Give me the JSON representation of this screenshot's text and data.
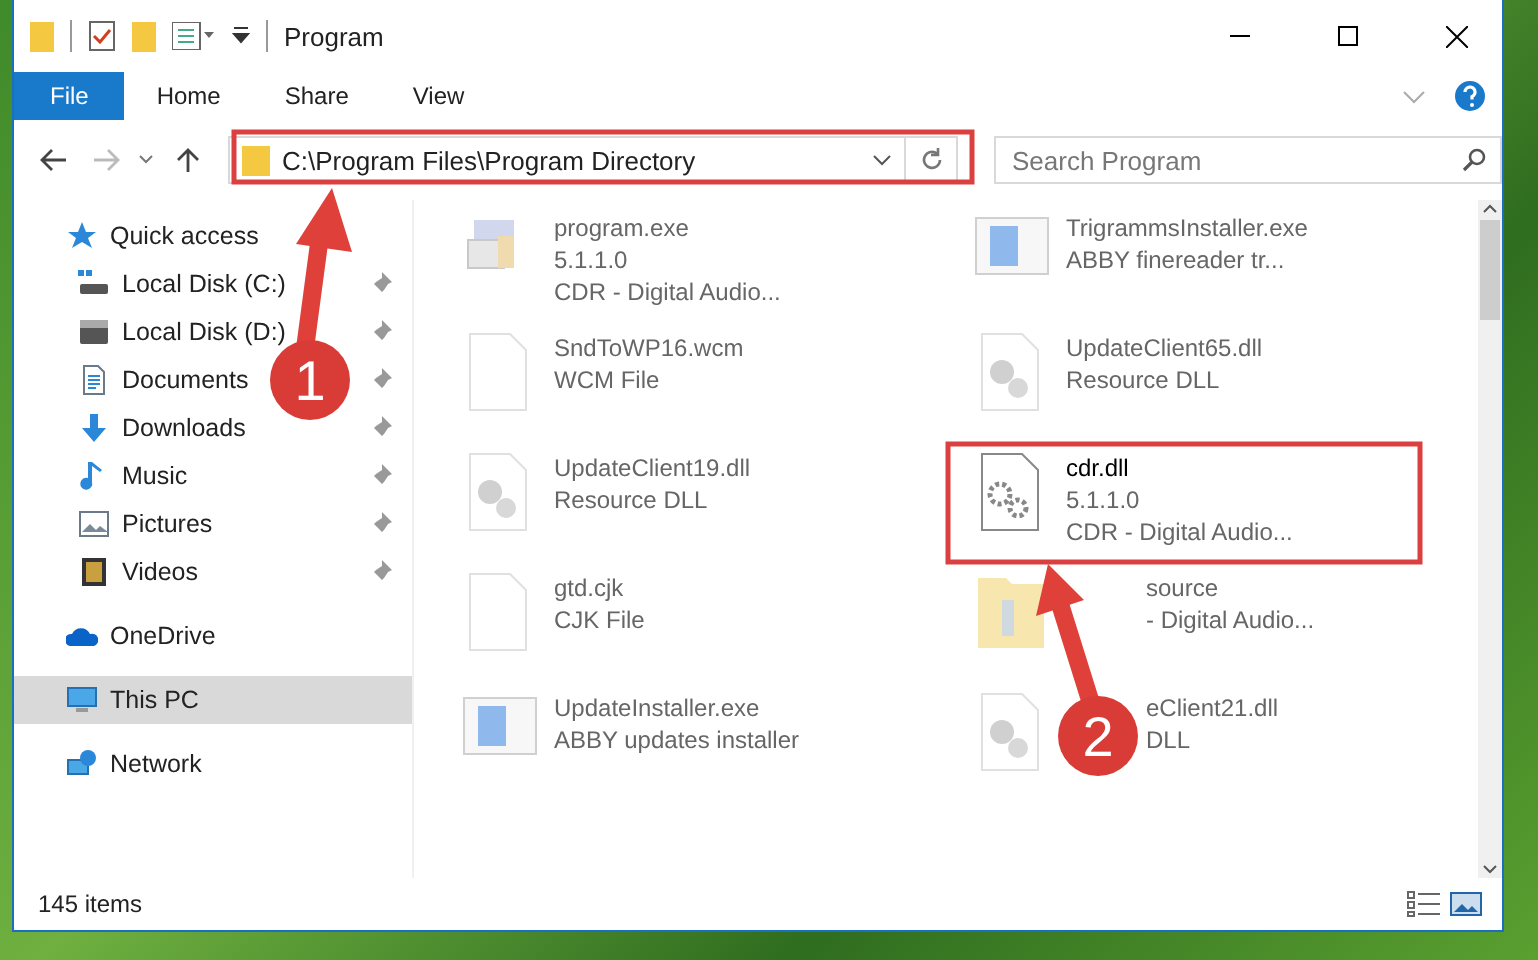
{
  "window": {
    "title": "Program"
  },
  "ribbon_tabs": [
    {
      "label": "File",
      "selected": true
    },
    {
      "label": "Home",
      "selected": false
    },
    {
      "label": "Share",
      "selected": false
    },
    {
      "label": "View",
      "selected": false
    }
  ],
  "address_bar": {
    "path": "C:\\Program Files\\Program Directory"
  },
  "search": {
    "placeholder": "Search Program"
  },
  "sidebar": {
    "items": [
      {
        "label": "Quick access",
        "kind": "star",
        "pinned": false,
        "selected": false,
        "children": [
          {
            "label": "Local Disk (C:)",
            "kind": "disk-c",
            "pinned": true,
            "selected": false
          },
          {
            "label": "Local Disk (D:)",
            "kind": "disk",
            "pinned": true,
            "selected": false
          },
          {
            "label": "Documents",
            "kind": "document",
            "pinned": true,
            "selected": false
          },
          {
            "label": "Downloads",
            "kind": "download",
            "pinned": true,
            "selected": false
          },
          {
            "label": "Music",
            "kind": "music",
            "pinned": true,
            "selected": false
          },
          {
            "label": "Pictures",
            "kind": "pictures",
            "pinned": true,
            "selected": false
          },
          {
            "label": "Videos",
            "kind": "videos",
            "pinned": true,
            "selected": false
          }
        ]
      },
      {
        "label": "OneDrive",
        "kind": "cloud",
        "pinned": false,
        "selected": false
      },
      {
        "label": "This PC",
        "kind": "pc",
        "pinned": false,
        "selected": true
      },
      {
        "label": "Network",
        "kind": "network",
        "pinned": false,
        "selected": false
      }
    ]
  },
  "files": [
    {
      "name": "program.exe",
      "lines": [
        "5.1.1.0",
        "CDR - Digital Audio..."
      ],
      "kind": "exe",
      "blurred": true,
      "covered": false
    },
    {
      "name": "TrigrammsInstaller.exe",
      "lines": [
        "ABBY finereader tr..."
      ],
      "kind": "installer",
      "blurred": true,
      "covered": false
    },
    {
      "name": "SndToWP16.wcm",
      "lines": [
        "WCM File"
      ],
      "kind": "file",
      "blurred": true,
      "covered": false
    },
    {
      "name": "UpdateClient65.dll",
      "lines": [
        "Resource DLL"
      ],
      "kind": "dll",
      "blurred": true,
      "covered": false
    },
    {
      "name": "UpdateClient19.dll",
      "lines": [
        "Resource DLL"
      ],
      "kind": "dll",
      "blurred": true,
      "covered": false
    },
    {
      "name": "cdr.dll",
      "lines": [
        "5.1.1.0",
        "CDR - Digital Audio..."
      ],
      "kind": "gear-dll",
      "blurred": false,
      "covered": false
    },
    {
      "name": "gtd.cjk",
      "lines": [
        "CJK File"
      ],
      "kind": "file",
      "blurred": true,
      "covered": false
    },
    {
      "name": "source",
      "lines": [
        "- Digital Audio..."
      ],
      "kind": "folder",
      "blurred": true,
      "covered": true
    },
    {
      "name": "UpdateInstaller.exe",
      "lines": [
        "ABBY updates installer"
      ],
      "kind": "installer",
      "blurred": true,
      "covered": false
    },
    {
      "name": "eClient21.dll",
      "lines": [
        "DLL"
      ],
      "kind": "dll",
      "blurred": true,
      "covered": true
    }
  ],
  "status_bar": {
    "count": "145 items"
  },
  "annotations": [
    {
      "label": "1"
    },
    {
      "label": "2"
    }
  ]
}
